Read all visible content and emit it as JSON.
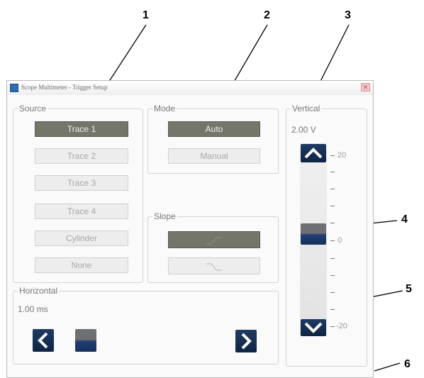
{
  "window": {
    "title": "Scope Multimeter - Trigger Setup"
  },
  "source": {
    "legend": "Source",
    "items": [
      "Trace 1",
      "Trace 2",
      "Trace 3",
      "Trace 4",
      "Cylinder",
      "None"
    ],
    "selected": "Trace 1"
  },
  "mode": {
    "legend": "Mode",
    "items": [
      "Auto",
      "Manual"
    ],
    "selected": "Auto"
  },
  "slope": {
    "legend": "Slope",
    "items": [
      "rising",
      "falling"
    ],
    "selected": "rising"
  },
  "vertical": {
    "legend": "Vertical",
    "value": "2.00 V",
    "scale_top": "20",
    "scale_mid": "0",
    "scale_bottom": "-20",
    "up_icon": "chevron-up-icon",
    "down_icon": "chevron-down-icon",
    "level": 0
  },
  "horizontal": {
    "legend": "Horizontal",
    "value": "1.00 ms",
    "left_icon": "chevron-left-icon",
    "right_icon": "chevron-right-icon"
  },
  "callouts": [
    "1",
    "2",
    "3",
    "4",
    "5",
    "6"
  ],
  "colors": {
    "active_button": "#74766a",
    "arrow_button": "#1e3b63",
    "slider_blue": "#1f3e73"
  }
}
